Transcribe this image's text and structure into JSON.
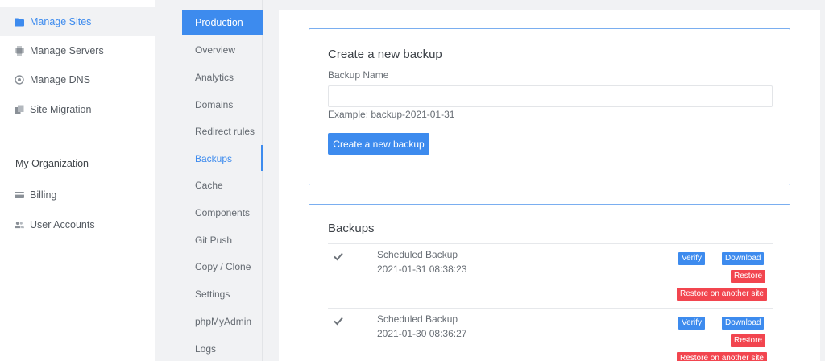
{
  "sidebar": {
    "items": [
      {
        "label": "Manage Sites",
        "icon": "folder-icon",
        "active": true
      },
      {
        "label": "Manage Servers",
        "icon": "chip-icon",
        "active": false
      },
      {
        "label": "Manage DNS",
        "icon": "globe-icon",
        "active": false
      },
      {
        "label": "Site Migration",
        "icon": "copy-icon",
        "active": false
      }
    ],
    "org_heading": "My Organization",
    "org_items": [
      {
        "label": "Billing",
        "icon": "credit-card-icon"
      },
      {
        "label": "User Accounts",
        "icon": "users-icon"
      }
    ]
  },
  "subnav": {
    "active_tab": "Production",
    "items": [
      "Overview",
      "Analytics",
      "Domains",
      "Redirect rules",
      "Backups",
      "Cache",
      "Components",
      "Git Push",
      "Copy / Clone",
      "Settings",
      "phpMyAdmin",
      "Logs"
    ],
    "current": "Backups"
  },
  "create_backup": {
    "title": "Create a new backup",
    "name_label": "Backup Name",
    "name_value": "",
    "hint": "Example: backup-2021-01-31",
    "button": "Create a new backup"
  },
  "backups": {
    "title": "Backups",
    "rows": [
      {
        "name": "Scheduled Backup",
        "date": "2021-01-31 08:38:23",
        "verify": "Verify",
        "download": "Download",
        "restore": "Restore",
        "restore_other": "Restore on another site"
      },
      {
        "name": "Scheduled Backup",
        "date": "2021-01-30 08:36:27",
        "verify": "Verify",
        "download": "Download",
        "restore": "Restore",
        "restore_other": "Restore on another site"
      }
    ]
  },
  "colors": {
    "accent": "#3d8bee",
    "danger": "#f2454f",
    "card_border": "#7aaef0",
    "page_bg": "#f1f2f4"
  }
}
